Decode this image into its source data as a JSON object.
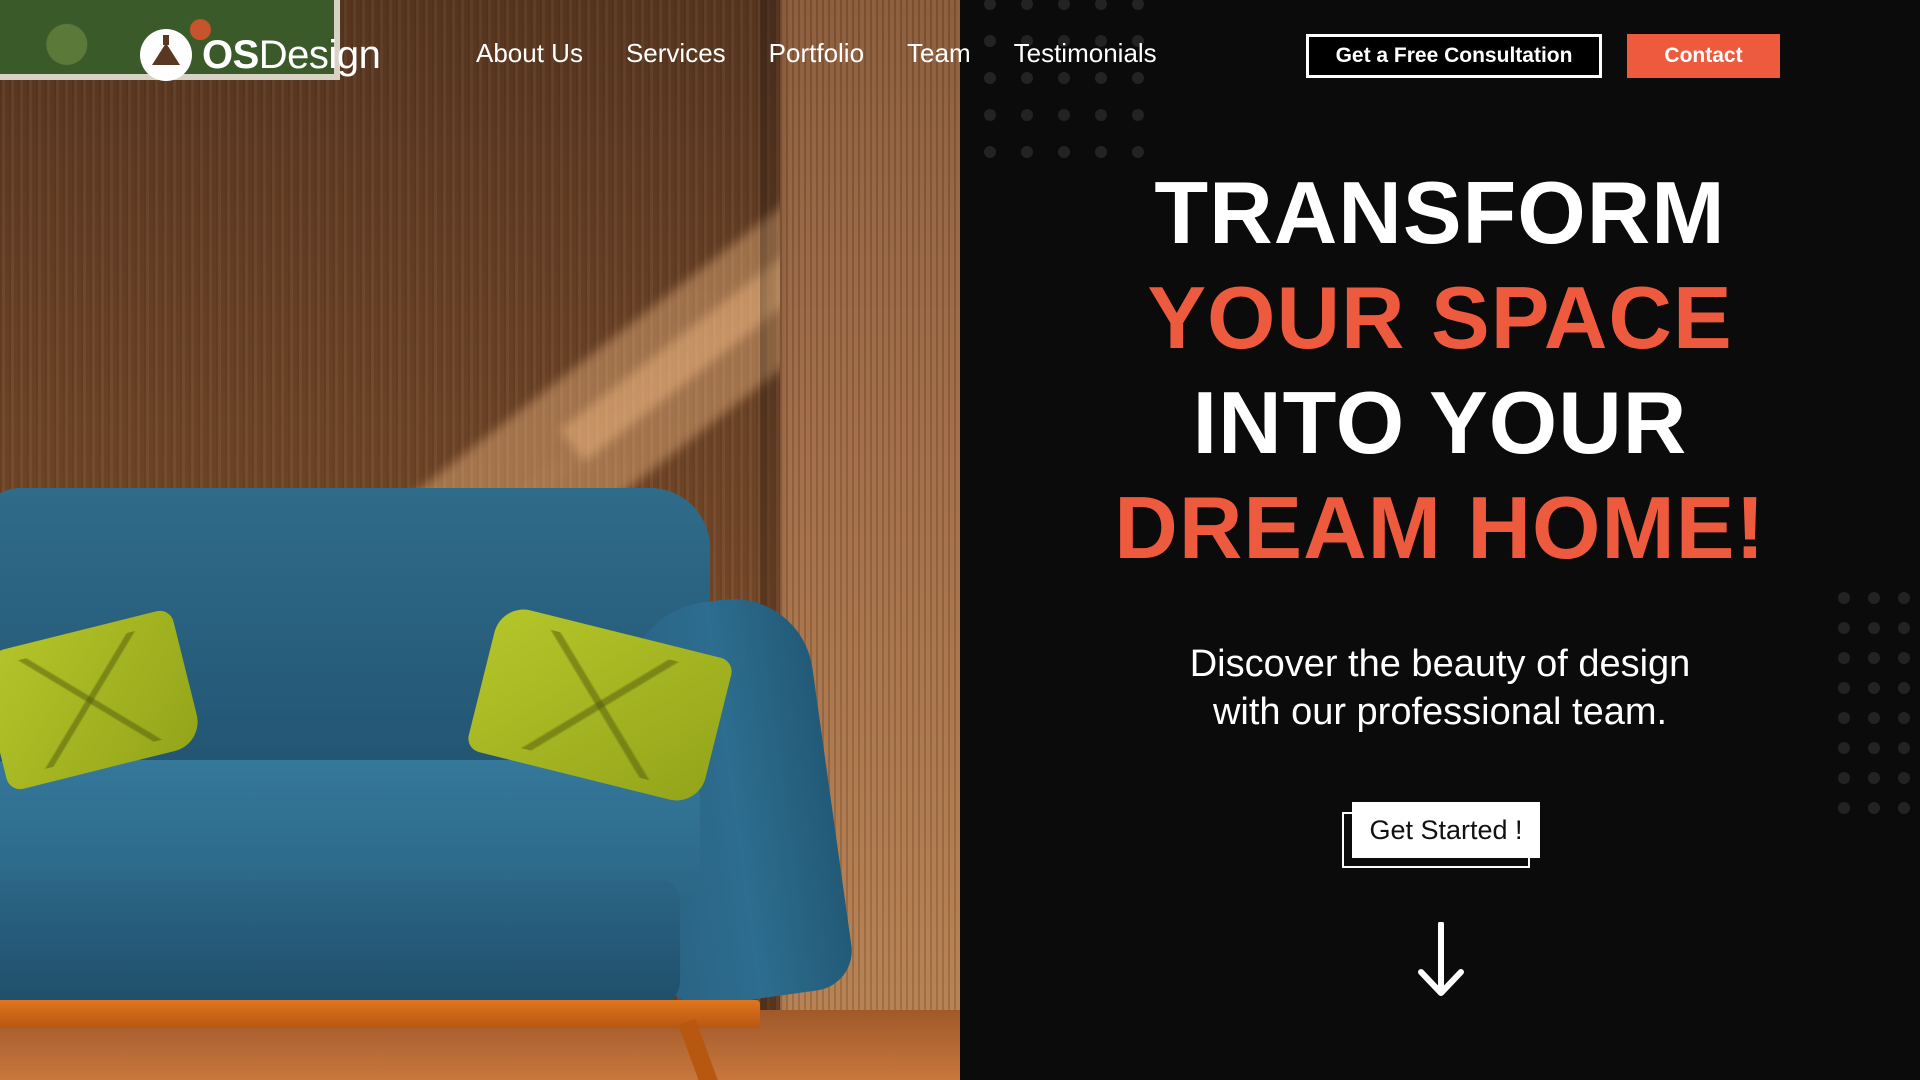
{
  "brand": {
    "logo_bold": "OS",
    "logo_light": "Design",
    "logo_icon": "lamp-icon"
  },
  "nav": {
    "items": [
      {
        "label": "About Us"
      },
      {
        "label": "Services"
      },
      {
        "label": "Portfolio"
      },
      {
        "label": "Team"
      },
      {
        "label": "Testimonials"
      }
    ],
    "consult_label": "Get a Free Consultation",
    "contact_label": "Contact"
  },
  "hero": {
    "line1": "TRANSFORM",
    "line2": "YOUR SPACE",
    "line3": "INTO YOUR",
    "line4": "DREAM HOME!",
    "subtitle_line1": "Discover the beauty of design",
    "subtitle_line2": "with our professional team.",
    "cta_label": "Get Started !",
    "scroll_icon": "arrow-down-icon"
  },
  "colors": {
    "accent": "#ee5a3e",
    "background": "#0b0b0b",
    "text": "#ffffff"
  }
}
